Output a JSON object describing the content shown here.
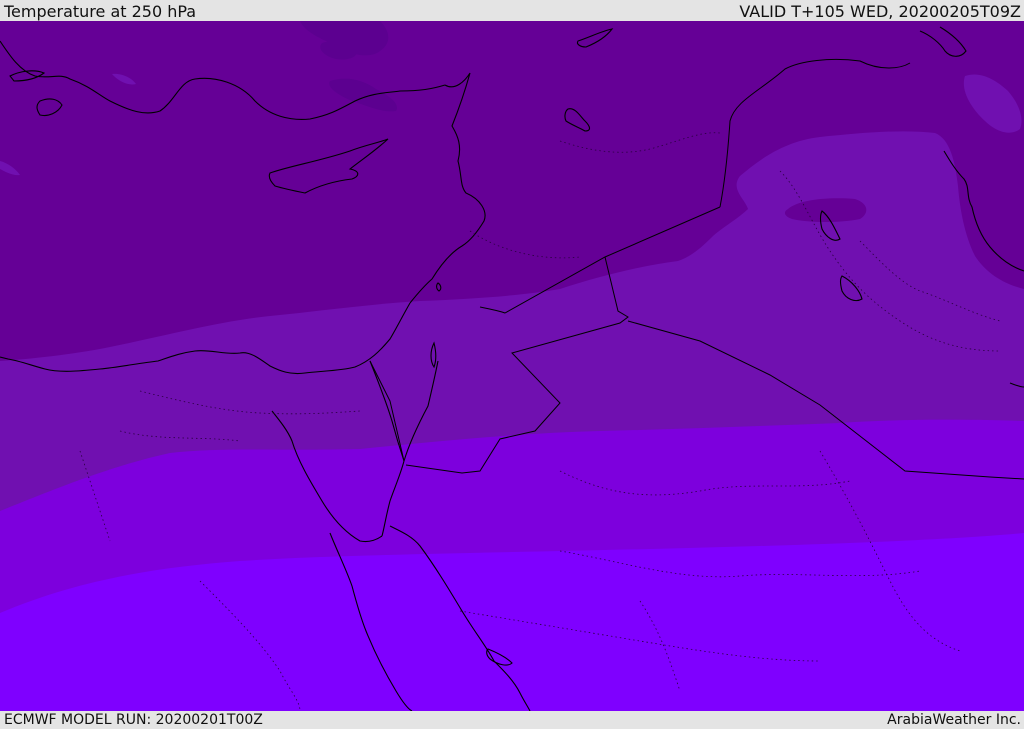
{
  "header": {
    "title": "Temperature at 250 hPa",
    "valid": "VALID T+105 WED, 20200205T09Z"
  },
  "footer": {
    "model_run": "ECMWF MODEL RUN: 20200201T00Z",
    "credit": "ArabiaWeather Inc."
  },
  "map": {
    "fill_bands": [
      {
        "name": "band-darkest",
        "color": "#5c0090"
      },
      {
        "name": "band-dark",
        "color": "#650096"
      },
      {
        "name": "band-mid",
        "color": "#7010b0"
      },
      {
        "name": "band-bright",
        "color": "#7d00dd"
      },
      {
        "name": "band-brightest",
        "color": "#7f00ff"
      }
    ],
    "coastline_color": "#000000"
  }
}
